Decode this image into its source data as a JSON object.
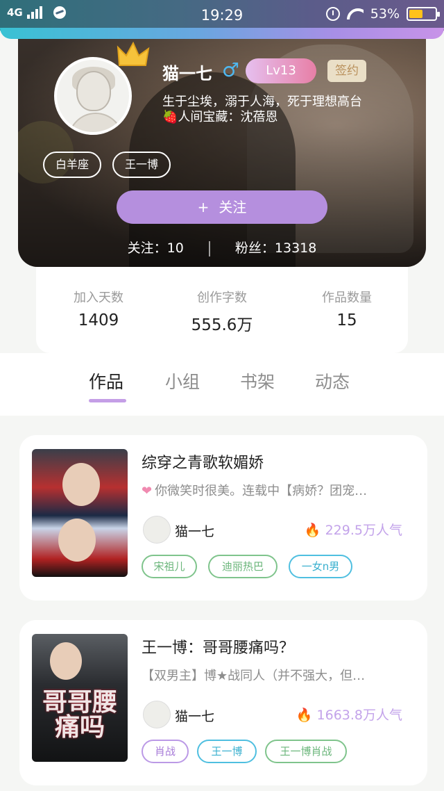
{
  "status_bar": {
    "network": "4G",
    "time": "19:29",
    "battery": "53%",
    "battery_level": 0.53
  },
  "profile": {
    "name": "猫一七",
    "gender_symbol": "♂",
    "level": "Lv13",
    "signed_badge": "签约",
    "bio_line1": "生于尘埃，溺于人海，死于理想高台",
    "bio_line2": "🍓人间宝藏：沈蓓恩",
    "tags": [
      "白羊座",
      "王一博"
    ],
    "follow_button": "关注",
    "follow_plus": "+",
    "following_text": "关注：10",
    "fans_text": "粉丝：13318"
  },
  "stats": [
    {
      "label": "加入天数",
      "value": "1409"
    },
    {
      "label": "创作字数",
      "value": "555.6万"
    },
    {
      "label": "作品数量",
      "value": "15"
    }
  ],
  "tabs": [
    "作品",
    "小组",
    "书架",
    "动态"
  ],
  "active_tab": "作品",
  "works": [
    {
      "title": "综穿之青歌软媚娇",
      "description": "你微笑时很美。连载中【病娇？团宠…",
      "author": "猫一七",
      "popularity": "229.5万人气",
      "tags": [
        "宋祖儿",
        "迪丽热巴",
        "一女n男"
      ]
    },
    {
      "title": "王一博：哥哥腰痛吗？",
      "description": "【双男主】博★战同人（并不强大，但…",
      "author": "猫一七",
      "popularity": "1663.8万人气",
      "tags": [
        "肖战",
        "王一博",
        "王一博肖战"
      ],
      "cover_text": "哥哥腰痛吗"
    }
  ],
  "colors": {
    "accent_purple": "#b58fde",
    "tab_indicator": "#c49ee6",
    "popularity": "#c3a3ea"
  }
}
